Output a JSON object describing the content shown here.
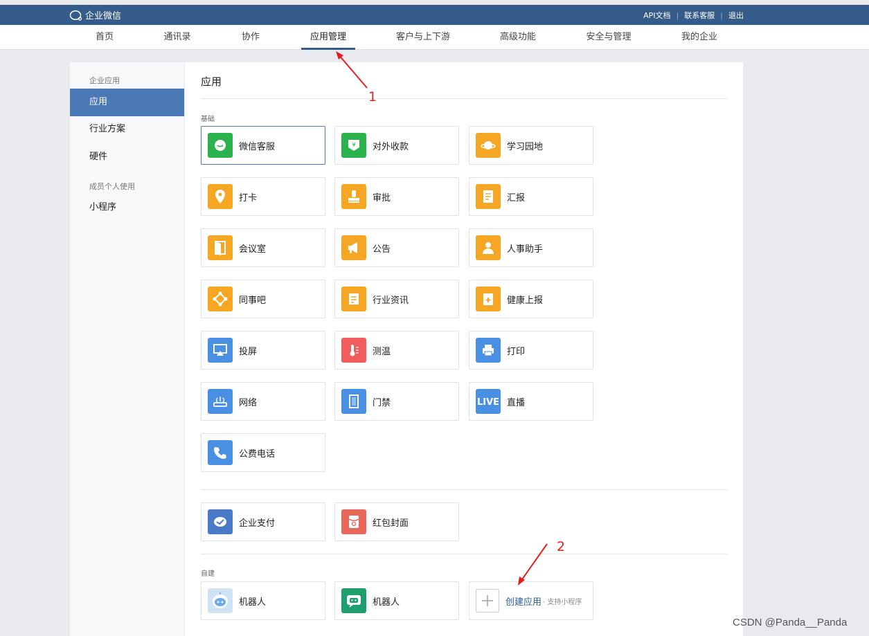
{
  "header": {
    "logo_text": "企业微信",
    "links": [
      "API文档",
      "联系客服",
      "退出"
    ]
  },
  "nav": {
    "items": [
      "首页",
      "通讯录",
      "协作",
      "应用管理",
      "客户与上下游",
      "高级功能",
      "安全与管理",
      "我的企业"
    ],
    "active": "应用管理"
  },
  "sidebar": {
    "group1": "企业应用",
    "items1": [
      "应用",
      "行业方案",
      "硬件"
    ],
    "group2": "成员个人使用",
    "items2": [
      "小程序"
    ]
  },
  "main": {
    "title": "应用",
    "basic_label": "基础",
    "basic_apps": [
      {
        "label": "微信客服",
        "icon": "wechat-service-icon",
        "color": "#2bb24c"
      },
      {
        "label": "对外收款",
        "icon": "payment-collection-icon",
        "color": "#2bb24c"
      },
      {
        "label": "学习园地",
        "icon": "planet-icon",
        "color": "#f5a623"
      },
      {
        "label": "打卡",
        "icon": "location-pin-icon",
        "color": "#f5a623"
      },
      {
        "label": "审批",
        "icon": "stamp-icon",
        "color": "#f5a623"
      },
      {
        "label": "汇报",
        "icon": "report-doc-icon",
        "color": "#f5a623"
      },
      {
        "label": "会议室",
        "icon": "door-icon",
        "color": "#f5a623"
      },
      {
        "label": "公告",
        "icon": "megaphone-icon",
        "color": "#f5a623"
      },
      {
        "label": "人事助手",
        "icon": "person-icon",
        "color": "#f5a623"
      },
      {
        "label": "同事吧",
        "icon": "network-icon",
        "color": "#f5a623"
      },
      {
        "label": "行业资讯",
        "icon": "news-icon",
        "color": "#f5a623"
      },
      {
        "label": "健康上报",
        "icon": "health-clipboard-icon",
        "color": "#f5a623"
      },
      {
        "label": "投屏",
        "icon": "screen-cast-icon",
        "color": "#4a90e2"
      },
      {
        "label": "测温",
        "icon": "thermometer-icon",
        "color": "#f25c5c"
      },
      {
        "label": "打印",
        "icon": "printer-icon",
        "color": "#4a90e2"
      },
      {
        "label": "网络",
        "icon": "router-icon",
        "color": "#4a90e2"
      },
      {
        "label": "门禁",
        "icon": "access-door-icon",
        "color": "#4a90e2"
      },
      {
        "label": "直播",
        "icon": "live-icon",
        "color": "#4a90e2"
      },
      {
        "label": "公费电话",
        "icon": "phone-icon",
        "color": "#4a90e2"
      }
    ],
    "extra_apps": [
      {
        "label": "企业支付",
        "icon": "enterprise-pay-icon",
        "color": "#4a79c8"
      },
      {
        "label": "红包封面",
        "icon": "red-envelope-icon",
        "color": "#e8685a"
      }
    ],
    "custom_label": "自建",
    "custom_apps": [
      {
        "label": "机器人",
        "icon": "robot-icon",
        "color": "#cfe3f5"
      },
      {
        "label": "机器人",
        "icon": "chatbot-icon",
        "color": "#1f9e6e"
      }
    ],
    "create": {
      "label": "创建应用",
      "sub": "· 支持小程序"
    }
  },
  "annotations": {
    "one": "1",
    "two": "2"
  },
  "watermark": "CSDN @Panda__Panda"
}
